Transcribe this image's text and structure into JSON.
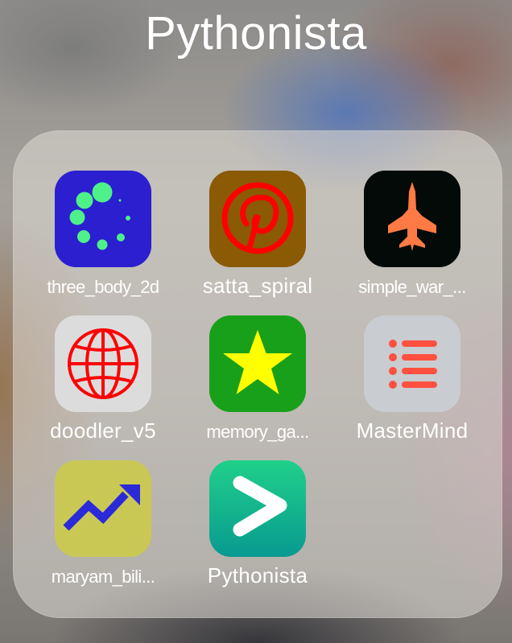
{
  "folder": {
    "title": "Pythonista"
  },
  "apps": [
    {
      "label": "three_body_2d",
      "icon": "dots-circle-icon",
      "bg": "#2b1fd0",
      "accent": "#4ef08a"
    },
    {
      "label": "satta_spiral",
      "icon": "pinterest-icon",
      "bg": "#8a5a05",
      "accent": "#ff0000"
    },
    {
      "label": "simple_war_...",
      "icon": "fighter-jet-icon",
      "bg": "#040a08",
      "accent": "#ff7a45"
    },
    {
      "label": "doodler_v5",
      "icon": "globe-icon",
      "bg": "#dcdcdc",
      "accent": "#ff0000"
    },
    {
      "label": "memory_ga...",
      "icon": "star-icon",
      "bg": "#18a01a",
      "accent": "#ffff00"
    },
    {
      "label": "MasterMind",
      "icon": "list-icon",
      "bg": "#c9ccd0",
      "accent": "#ff5040"
    },
    {
      "label": "maryam_bili...",
      "icon": "trend-arrow-icon",
      "bg": "#c9c855",
      "accent": "#2a2ad8"
    },
    {
      "label": "Pythonista",
      "icon": "chevron-right-icon",
      "bg": "#16c08c",
      "accent": "#ffffff"
    }
  ]
}
